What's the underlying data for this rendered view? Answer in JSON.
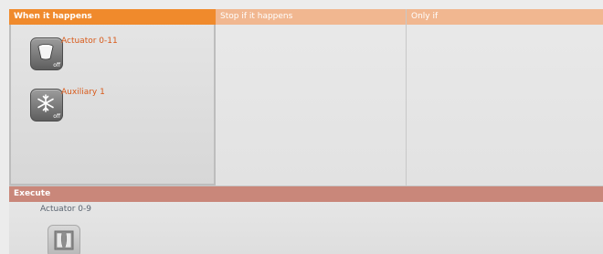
{
  "panels": {
    "when": {
      "header": "When it happens",
      "devices": [
        {
          "label": "Actuator 0-11",
          "state": "off",
          "icon": "bucket-icon"
        },
        {
          "label": "Auxiliary 1",
          "state": "off",
          "icon": "snowflake-icon"
        }
      ]
    },
    "stop": {
      "header": "Stop if it happens"
    },
    "only": {
      "header": "Only if"
    }
  },
  "execute": {
    "header": "Execute",
    "devices": [
      {
        "label": "Actuator 0-9",
        "icon": "curtain-window-icon"
      }
    ]
  },
  "colors": {
    "when_header": "#f08a2c",
    "stop_header": "#f1b790",
    "execute_header": "#c9877a",
    "device_label": "#d85a1a"
  }
}
